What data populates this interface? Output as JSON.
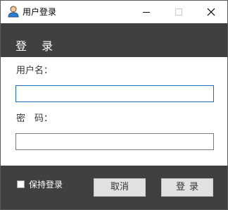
{
  "window": {
    "title": "用户登录",
    "icon": "user-avatar-icon",
    "controls": {
      "minimize_icon": "minimize-icon",
      "maximize_icon": "maximize-icon",
      "close_icon": "close-icon"
    }
  },
  "header": {
    "title": "登 录"
  },
  "form": {
    "username_label": "用户名：",
    "username_value": "",
    "password_label": "密　码：",
    "password_value": ""
  },
  "footer": {
    "remember_label": "保持登录",
    "remember_checked": false,
    "cancel_label": "取消",
    "login_label": "登录"
  },
  "colors": {
    "header_bg": "#404040",
    "footer_bg": "#404040",
    "focus_border": "#1d6fb8",
    "button_bg": "#e1e1e1"
  }
}
